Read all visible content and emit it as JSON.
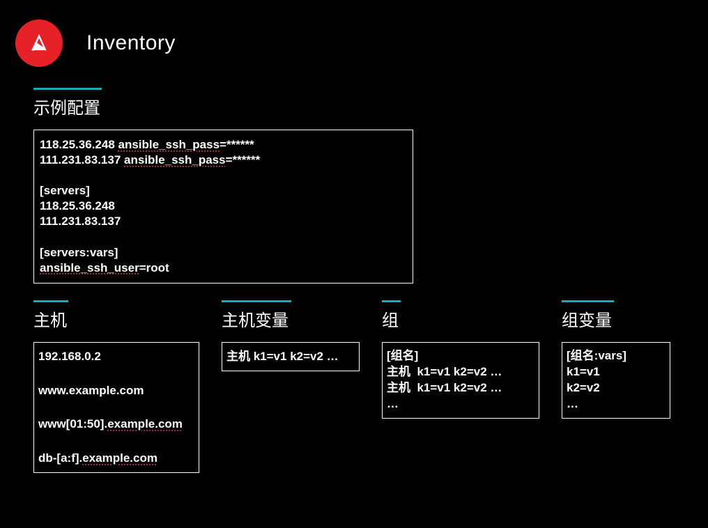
{
  "header": {
    "title": "Inventory"
  },
  "example": {
    "title": "示例配置",
    "lines": [
      {
        "t": "118.25.36.248 ",
        "u": "ansible_ssh_pass",
        "a": "=******"
      },
      {
        "t": "111.231.83.137 ",
        "u": "ansible_ssh_pass",
        "a": "=******"
      },
      {
        "t": "",
        "u": "",
        "a": ""
      },
      {
        "t": "[servers]",
        "u": "",
        "a": ""
      },
      {
        "t": "118.25.36.248",
        "u": "",
        "a": ""
      },
      {
        "t": "111.231.83.137",
        "u": "",
        "a": ""
      },
      {
        "t": "",
        "u": "",
        "a": ""
      },
      {
        "t": "[servers:vars]",
        "u": "",
        "a": ""
      },
      {
        "t": "",
        "u": "ansible_ssh_user",
        "a": "=root"
      }
    ]
  },
  "cols": {
    "host": {
      "title": "主机",
      "lines": [
        {
          "t": "192.168.0.2",
          "u": ""
        },
        {
          "t": "www.example.com",
          "u": ""
        },
        {
          "t": "www[01:50].",
          "u": "example.com"
        },
        {
          "t": "db-[a:f].",
          "u": "example.com"
        }
      ]
    },
    "hostvars": {
      "title": "主机变量",
      "content": "主机 k1=v1 k2=v2 …"
    },
    "group": {
      "title": "组",
      "content": "[组名]\n主机  k1=v1 k2=v2 …\n主机  k1=v1 k2=v2 …\n…"
    },
    "groupvars": {
      "title": "组变量",
      "content": "[组名:vars]\nk1=v1\nk2=v2\n…"
    }
  }
}
